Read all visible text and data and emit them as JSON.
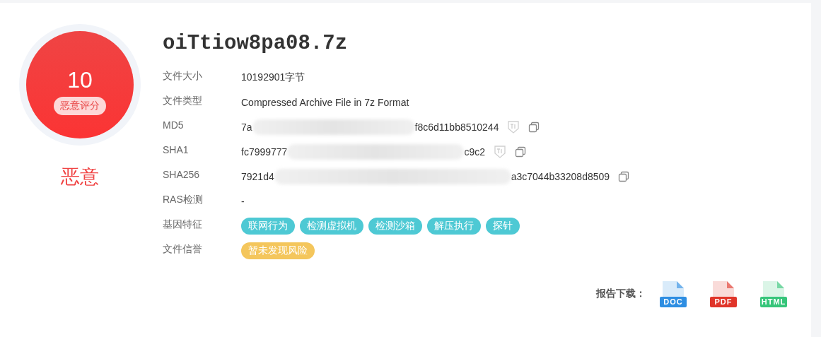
{
  "score": {
    "value": "10",
    "label": "恶意评分",
    "verdict": "恶意"
  },
  "file": {
    "name": "oiTtiow8pa08.7z"
  },
  "fields": [
    {
      "kind": "text",
      "label": "文件大小",
      "value": "10192901字节"
    },
    {
      "kind": "text",
      "label": "文件类型",
      "value": "Compressed Archive File in 7z Format"
    },
    {
      "kind": "hash",
      "label": "MD5",
      "prefix": "7a",
      "suffix": "f8c6d11bb8510244",
      "intel": true
    },
    {
      "kind": "hash",
      "label": "SHA1",
      "prefix": "fc7999777",
      "suffix": "c9c2",
      "intel": true
    },
    {
      "kind": "hash",
      "label": "SHA256",
      "prefix": "7921d4",
      "suffix": "a3c7044b33208d8509",
      "intel": false
    },
    {
      "kind": "text",
      "label": "RAS检测",
      "value": "-"
    },
    {
      "kind": "tags",
      "label": "基因特征",
      "tags": [
        {
          "text": "联网行为",
          "color": "#4ec9d4"
        },
        {
          "text": "检测虚拟机",
          "color": "#4ec9d4"
        },
        {
          "text": "检测沙箱",
          "color": "#4ec9d4"
        },
        {
          "text": "解压执行",
          "color": "#4ec9d4"
        },
        {
          "text": "探针",
          "color": "#4ec9d4"
        }
      ]
    },
    {
      "kind": "tags",
      "label": "文件信誉",
      "tags": [
        {
          "text": "暂未发现风险",
          "color": "#f4c65c"
        }
      ]
    }
  ],
  "downloads": {
    "label": "报告下载：",
    "files": [
      {
        "format": "DOC",
        "color": "#2e8ee2"
      },
      {
        "format": "PDF",
        "color": "#e0352a"
      },
      {
        "format": "HTML",
        "color": "#36c57a"
      }
    ]
  }
}
